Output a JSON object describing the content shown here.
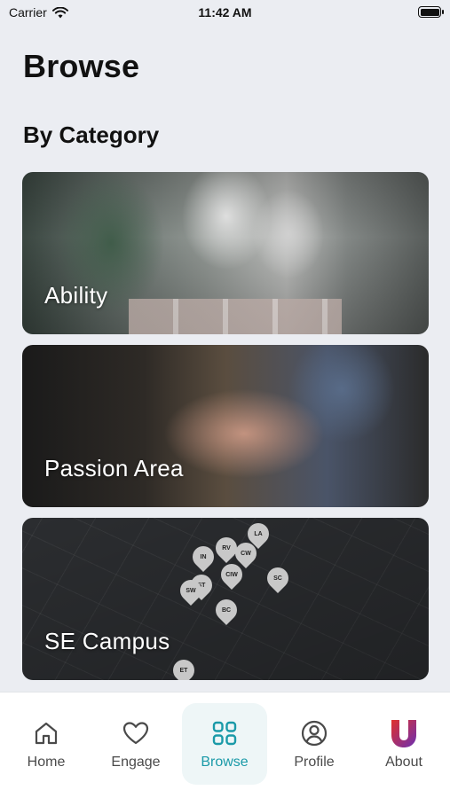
{
  "status": {
    "carrier": "Carrier",
    "time": "11:42 AM"
  },
  "page": {
    "title": "Browse",
    "section": "By Category"
  },
  "cards": [
    {
      "label": "Ability"
    },
    {
      "label": "Passion Area"
    },
    {
      "label": "SE Campus"
    }
  ],
  "map_pins": [
    {
      "code": "LA"
    },
    {
      "code": "RV"
    },
    {
      "code": "CW"
    },
    {
      "code": "IN"
    },
    {
      "code": "CIW"
    },
    {
      "code": "SC"
    },
    {
      "code": "ST"
    },
    {
      "code": "SW"
    },
    {
      "code": "BC"
    },
    {
      "code": "ET"
    }
  ],
  "tabs": [
    {
      "label": "Home",
      "icon": "home-icon"
    },
    {
      "label": "Engage",
      "icon": "heart-icon"
    },
    {
      "label": "Browse",
      "icon": "grid-icon"
    },
    {
      "label": "Profile",
      "icon": "user-circle-icon"
    },
    {
      "label": "About",
      "icon": "app-logo-icon"
    }
  ],
  "colors": {
    "accent": "#1a9aa8",
    "logo_red": "#e0312b",
    "logo_purple": "#6b2fb3"
  },
  "active_tab": "Browse"
}
